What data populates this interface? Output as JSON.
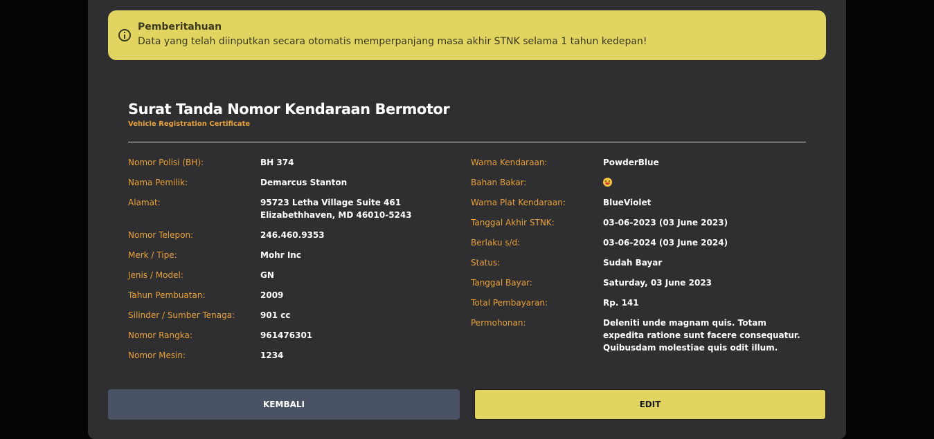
{
  "alert": {
    "title": "Pemberitahuan",
    "message": "Data yang telah diinputkan secara otomatis memperpanjang masa akhir STNK selama 1 tahun kedepan!",
    "icon": "info-circle-icon",
    "color": "#e2d460"
  },
  "document": {
    "title": "Surat Tanda Nomor Kendaraan Bermotor",
    "subtitle": "Vehicle Registration Certificate"
  },
  "left_fields": [
    {
      "label": "Nomor Polisi (BH):",
      "value": "BH 374"
    },
    {
      "label": "Nama Pemilik:",
      "value": "Demarcus Stanton"
    },
    {
      "label": "Alamat:",
      "value": "95723 Letha Village Suite 461 Elizabethhaven, MD 46010-5243"
    },
    {
      "label": "Nomor Telepon:",
      "value": "246.460.9353"
    },
    {
      "label": "Merk / Tipe:",
      "value": "Mohr Inc"
    },
    {
      "label": "Jenis / Model:",
      "value": "GN"
    },
    {
      "label": "Tahun Pembuatan:",
      "value": "2009"
    },
    {
      "label": "Silinder / Sumber Tenaga:",
      "value": "901 cc"
    },
    {
      "label": "Nomor Rangka:",
      "value": "961476301"
    },
    {
      "label": "Nomor Mesin:",
      "value": "1234"
    }
  ],
  "right_fields": [
    {
      "label": "Warna Kendaraan:",
      "value": "PowderBlue"
    },
    {
      "label": "Bahan Bakar:",
      "value": "",
      "icon": "grinning-face-emoji-icon"
    },
    {
      "label": "Warna Plat Kendaraan:",
      "value": "BlueViolet"
    },
    {
      "label": "Tanggal Akhir STNK:",
      "value": "03-06-2023 (03 June 2023)"
    },
    {
      "label": "Berlaku s/d:",
      "value": "03-06-2024 (03 June 2024)"
    },
    {
      "label": "Status:",
      "value": "Sudah Bayar"
    },
    {
      "label": "Tanggal Bayar:",
      "value": "Saturday, 03 June 2023"
    },
    {
      "label": "Total Pembayaran:",
      "value": "Rp. 141"
    },
    {
      "label": "Permohonan:",
      "value": "Deleniti unde magnam quis. Totam expedita ratione sunt facere consequatur. Quibusdam molestiae quis odit illum."
    }
  ],
  "buttons": {
    "back_label": "KEMBALI",
    "edit_label": "EDIT"
  },
  "colors": {
    "accent": "#e2d460",
    "label": "#e9a23b",
    "panel": "#2f2f31",
    "back_button": "#4a5365"
  }
}
